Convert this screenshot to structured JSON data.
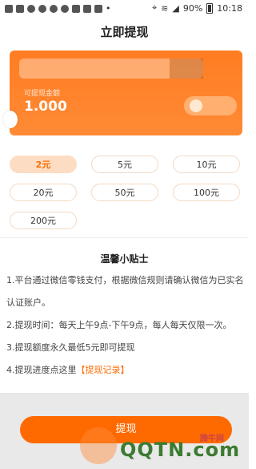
{
  "status_bar": {
    "battery": "90%",
    "time": "10:18"
  },
  "header": {
    "title": "立即提现"
  },
  "balance_card": {
    "label": "可提现金额",
    "amount": "1.000"
  },
  "amount_options": [
    {
      "label": "2元",
      "selected": true
    },
    {
      "label": "5元",
      "selected": false
    },
    {
      "label": "10元",
      "selected": false
    },
    {
      "label": "20元",
      "selected": false
    },
    {
      "label": "50元",
      "selected": false
    },
    {
      "label": "100元",
      "selected": false
    },
    {
      "label": "200元",
      "selected": false
    }
  ],
  "tips": {
    "title": "温馨小贴士",
    "line1a": "1.平台通过微信零钱支付，根据微信规则请确认微信为已实名",
    "line1b": "认证账户。",
    "line2": "2.提现时间：每天上午9点-下午9点，每人每天仅限一次。",
    "line3": "3.提现额度永久最低5元即可提现",
    "line4_text": "4.提现进度点这里",
    "line4_link": "【提现记录】"
  },
  "withdraw_button": {
    "label": "提现"
  },
  "watermark": {
    "text": "QQTN.com",
    "badge": "腾牛网"
  },
  "colors": {
    "accent": "#ff6a00",
    "card": "#ff7d22",
    "selected_bg": "#fcddc4"
  }
}
